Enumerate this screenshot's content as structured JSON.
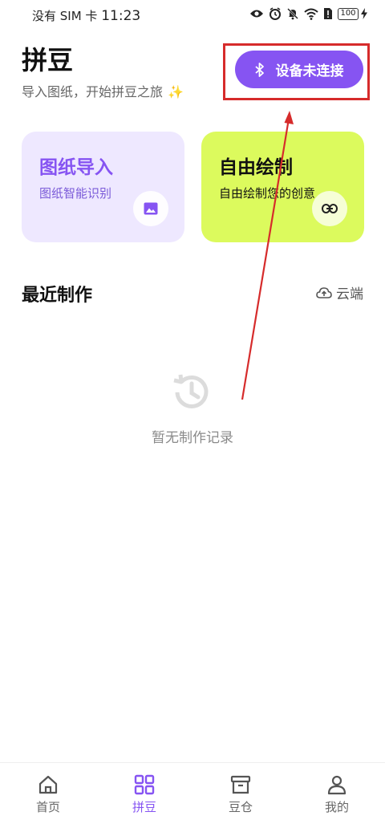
{
  "status_bar": {
    "carrier": "没有 SIM 卡",
    "time": "11:23",
    "battery": "100"
  },
  "header": {
    "title": "拼豆",
    "subtitle": "导入图纸，开始拼豆之旅",
    "sparkle": "✨",
    "connect_button_label": "设备未连接"
  },
  "cards": {
    "import": {
      "title": "图纸导入",
      "desc": "图纸智能识别"
    },
    "draw": {
      "title": "自由绘制",
      "desc": "自由绘制您的创意"
    }
  },
  "recent": {
    "title": "最近制作",
    "cloud_label": "云端",
    "empty_text": "暂无制作记录"
  },
  "nav": {
    "items": [
      {
        "label": "首页",
        "icon": "home-icon"
      },
      {
        "label": "拼豆",
        "icon": "grid-icon",
        "active": true
      },
      {
        "label": "豆仓",
        "icon": "archive-icon"
      },
      {
        "label": "我的",
        "icon": "person-icon"
      }
    ]
  },
  "colors": {
    "accent": "#8654f2",
    "lime": "#dcfa5d",
    "lavender": "#eee8ff",
    "annotation": "#d62b2b"
  }
}
